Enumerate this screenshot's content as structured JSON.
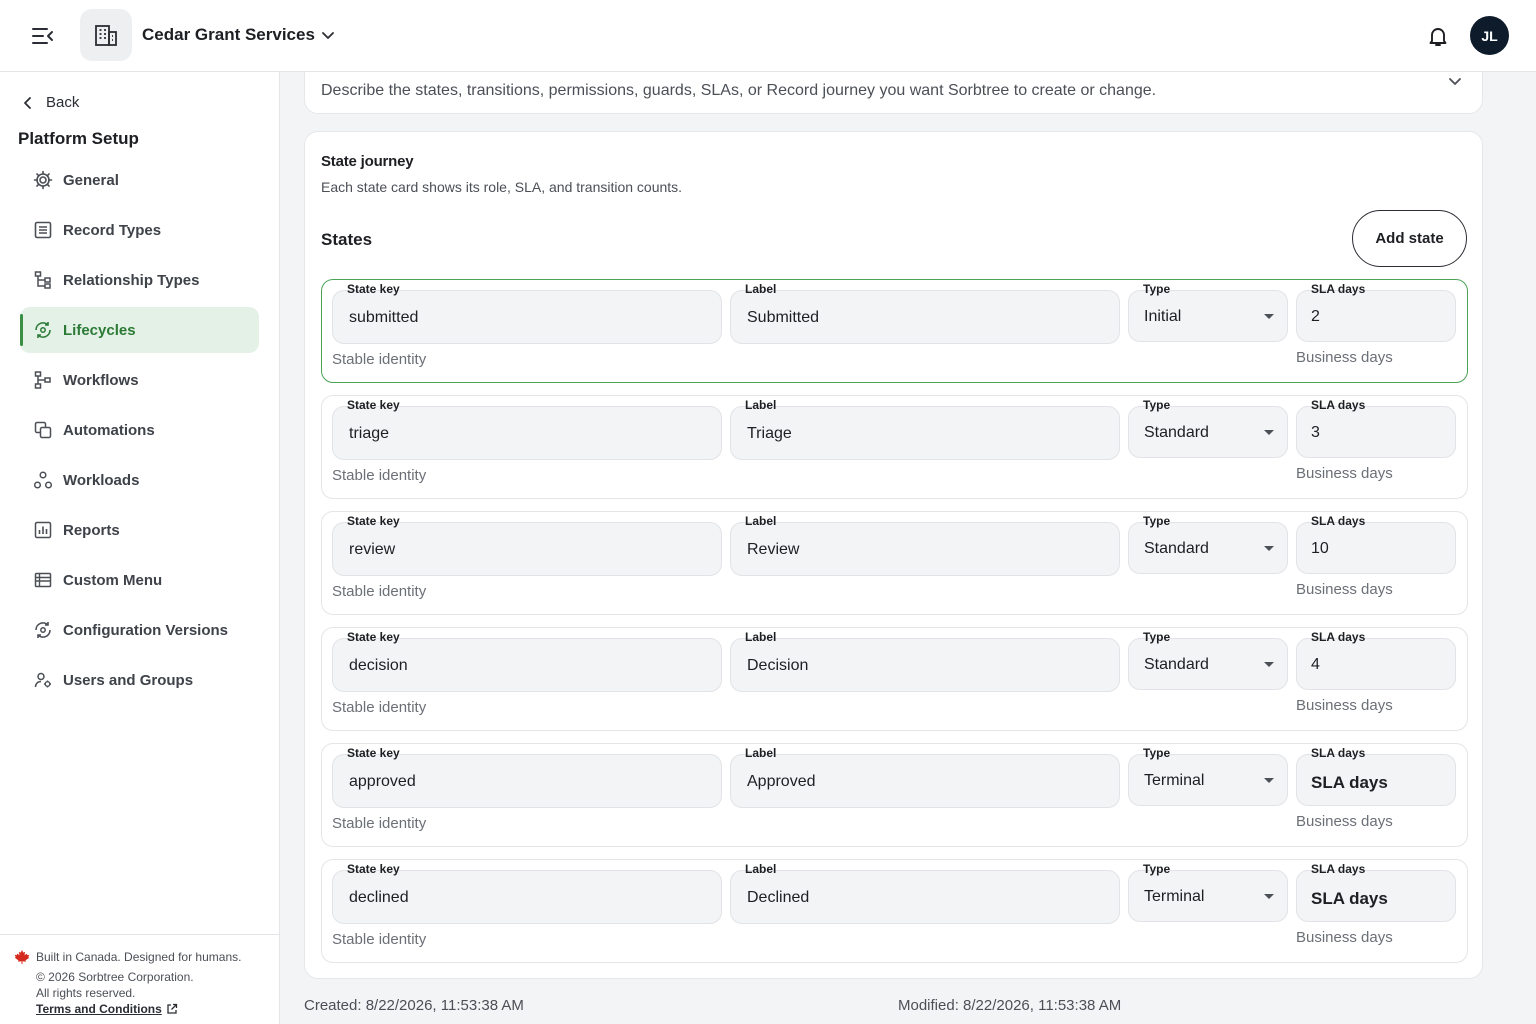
{
  "header": {
    "org_name": "Cedar Grant Services",
    "avatar_initials": "JL",
    "icons": [
      "menu-collapse-icon",
      "building-icon",
      "chevron-down-icon",
      "bell-icon"
    ]
  },
  "sidebar": {
    "back_label": "Back",
    "section_title": "Platform Setup",
    "items": [
      {
        "label": "General",
        "icon": "gear-icon",
        "active": false
      },
      {
        "label": "Record Types",
        "icon": "list-icon",
        "active": false
      },
      {
        "label": "Relationship Types",
        "icon": "hierarchy-icon",
        "active": false
      },
      {
        "label": "Lifecycles",
        "icon": "lifecycle-icon",
        "active": true
      },
      {
        "label": "Workflows",
        "icon": "workflow-icon",
        "active": false
      },
      {
        "label": "Automations",
        "icon": "automation-icon",
        "active": false
      },
      {
        "label": "Workloads",
        "icon": "workload-icon",
        "active": false
      },
      {
        "label": "Reports",
        "icon": "report-icon",
        "active": false
      },
      {
        "label": "Custom Menu",
        "icon": "menu-table-icon",
        "active": false
      },
      {
        "label": "Configuration Versions",
        "icon": "history-icon",
        "active": false
      },
      {
        "label": "Users and Groups",
        "icon": "users-icon",
        "active": false
      }
    ],
    "footer": {
      "line1": "Built in Canada. Designed for humans.",
      "line2": "© 2026 Sorbtree Corporation.",
      "line3": "All rights reserved.",
      "terms_label": "Terms and Conditions"
    }
  },
  "main": {
    "top_description": "Describe the states, transitions, permissions, guards, SLAs, or Record journey you want Sorbtree to create or change.",
    "journey_title": "State journey",
    "journey_subtitle": "Each state card shows its role, SLA, and transition counts.",
    "states_title": "States",
    "add_state_label": "Add state",
    "field_labels": {
      "state_key": "State key",
      "label": "Label",
      "type": "Type",
      "sla_days": "SLA days",
      "sla_placeholder": "SLA days",
      "key_helper": "Stable identity",
      "sla_helper": "Business days"
    },
    "states": [
      {
        "key": "submitted",
        "label": "Submitted",
        "type": "Initial",
        "sla": "2",
        "selected": true
      },
      {
        "key": "triage",
        "label": "Triage",
        "type": "Standard",
        "sla": "3",
        "selected": false
      },
      {
        "key": "review",
        "label": "Review",
        "type": "Standard",
        "sla": "10",
        "selected": false
      },
      {
        "key": "decision",
        "label": "Decision",
        "type": "Standard",
        "sla": "4",
        "selected": false
      },
      {
        "key": "approved",
        "label": "Approved",
        "type": "Terminal",
        "sla": "",
        "selected": false
      },
      {
        "key": "declined",
        "label": "Declined",
        "type": "Terminal",
        "sla": "",
        "selected": false
      }
    ],
    "created": "Created: 8/22/2026, 11:53:38 AM",
    "modified": "Modified: 8/22/2026, 11:53:38 AM"
  },
  "colors": {
    "accent_green": "#3a8f44",
    "active_bg": "#e4f1e6",
    "avatar_bg": "#0d1b2a"
  }
}
